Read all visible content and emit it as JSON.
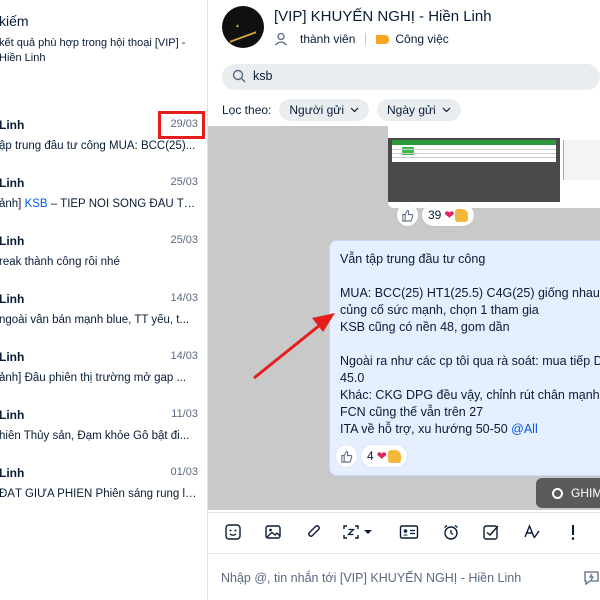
{
  "search_panel": {
    "title": "kiếm",
    "description": "kết quả phù hợp trong hội thoại [VIP] - Hiền Linh",
    "results": [
      {
        "name": "Linh",
        "date": "29/03",
        "preview_parts": [
          "ập trung đầu tư công MUA: BCC(25)...",
          ""
        ]
      },
      {
        "name": "Linh",
        "date": "25/03",
        "preview_parts": [
          "ảnh] ",
          "KSB",
          " – TIẾP NỐI SÓNG ĐẦU TƯ..."
        ]
      },
      {
        "name": "Linh",
        "date": "25/03",
        "preview_parts": [
          "reak thành công rồi nhé",
          ""
        ]
      },
      {
        "name": "Linh",
        "date": "14/03",
        "preview_parts": [
          "ngoài vẫn bán mạnh blue, TT yếu, t...",
          ""
        ]
      },
      {
        "name": "Linh",
        "date": "14/03",
        "preview_parts": [
          "ảnh] Đầu phiên thị trường mở gap ...",
          ""
        ]
      },
      {
        "name": "Linh",
        "date": "11/03",
        "preview_parts": [
          "hiên Thủy sản, Đạm khỏe Gỗ bật đi...",
          ""
        ]
      },
      {
        "name": "Linh",
        "date": "01/03",
        "preview_parts": [
          "ĐÁT GIỮA PHIÊN Phiên sáng rung lắ...",
          ""
        ]
      }
    ]
  },
  "conversation": {
    "title": "[VIP] KHUYẾN NGHỊ - Hiền Linh",
    "members_label": "thành viên",
    "category_label": "Công việc",
    "category_color": "#f5a623",
    "search_value": "ksb",
    "filter_label": "Lọc theo:",
    "filter_sender": "Người gửi",
    "filter_date": "Ngày gửi"
  },
  "messages": {
    "image_reactions": {
      "count": "39"
    },
    "text_message": {
      "lines": [
        "Vẫn tập trung đầu tư công",
        "",
        "MUA: BCC(25) HT1(25.5) C4G(25) giống nhau, l",
        "củng cố sức mạnh, chọn 1 tham gia",
        "KSB cũng có nền 48, gom dần",
        "",
        "Ngoài ra như các cp tôi qua rà soát: mua tiếp D",
        "45.0",
        "Khác: CKG DPG đều vậy, chỉnh rút chân mạnh,",
        "FCN cũng thế vẫn trên 27"
      ],
      "last_line_text": "ITA về hỗ trợ, xu hướng 50-50 ",
      "mention": "@All",
      "reaction_count": "4"
    },
    "pinned_label": "GHIM"
  },
  "composer": {
    "placeholder": "Nhập @, tin nhắn tới [VIP] KHUYẾN NGHỊ - Hiền Linh"
  },
  "colors": {
    "accent": "#005ae0",
    "highlight_box": "#e41d1d",
    "annotation_arrow": "#e41d1d"
  }
}
